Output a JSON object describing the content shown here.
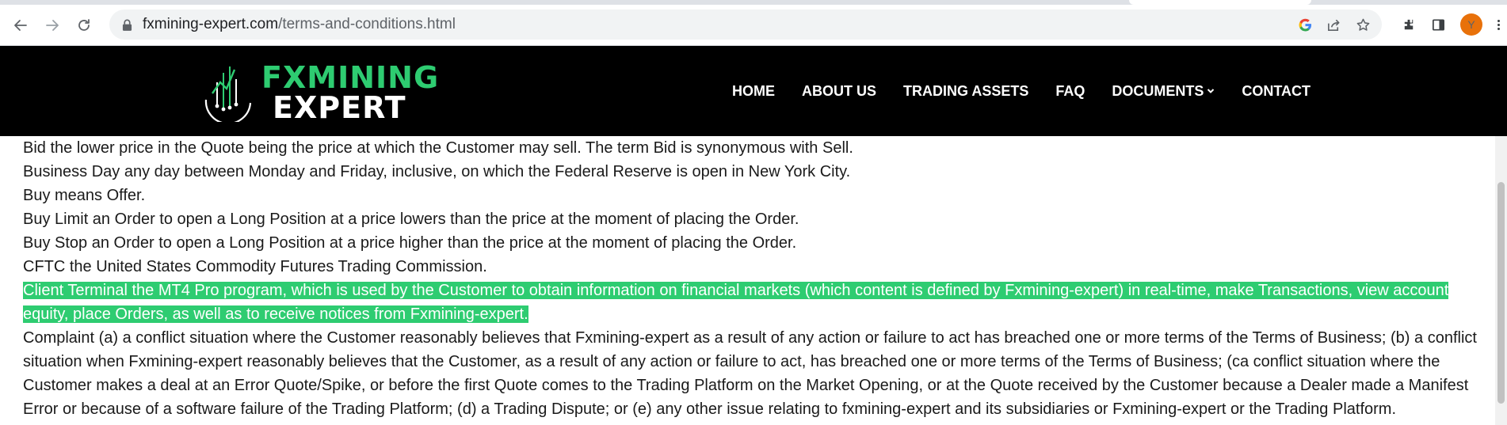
{
  "browser": {
    "url_domain": "fxmining-expert.com",
    "url_path": "/terms-and-conditions.html",
    "profile_initial": "Y",
    "icons": [
      "back-icon",
      "forward-icon",
      "reload-icon",
      "lock-icon",
      "google-icon",
      "share-icon",
      "star-icon",
      "extensions-icon",
      "side-panel-icon",
      "menu-icon"
    ]
  },
  "site": {
    "logo_line1": "FXMINING",
    "logo_line2": "EXPERT",
    "nav": [
      "HOME",
      "ABOUT US",
      "TRADING ASSETS",
      "FAQ",
      "DOCUMENTS",
      "CONTACT"
    ]
  },
  "content": {
    "paragraphs": [
      "Bid the lower price in the Quote being the price at which the Customer may sell. The term Bid is synonymous with Sell.",
      "Business Day any day between Monday and Friday, inclusive, on which the Federal Reserve is open in New York City.",
      "Buy means Offer.",
      "Buy Limit an Order to open a Long Position at a price lowers than the price at the moment of placing the Order.",
      "Buy Stop an Order to open a Long Position at a price higher than the price at the moment of placing the Order.",
      "CFTC the United States Commodity Futures Trading Commission."
    ],
    "highlighted": "Client Terminal the MT4 Pro program, which is used by the Customer to obtain information on financial markets (which content is defined by Fxmining-expert) in real-time, make Transactions, view account equity, place Orders, as well as to receive notices from Fxmining-expert.",
    "complaint": "Complaint (a) a conflict situation where the Customer reasonably believes that Fxmining-expert as a result of any action or failure to act has breached one or more terms of the Terms of Business; (b) a conflict situation when Fxmining-expert reasonably believes that the Customer, as a result of any action or failure to act, has breached one or more terms of the Terms of Business; (ca conflict situation where the Customer makes a deal at an Error Quote/Spike, or before the first Quote comes to the Trading Platform on the Market Opening, or at the Quote received by the Customer because a Dealer made a Manifest Error or because of a software failure of the Trading Platform; (d) a Trading Dispute; or (e) any other issue relating to fxmining-expert  and its subsidiaries or Fxmining-expert or the Trading Platform."
  },
  "colors": {
    "brand_green": "#2ecc71",
    "header_bg": "#000000",
    "avatar_bg": "#e8710a"
  }
}
